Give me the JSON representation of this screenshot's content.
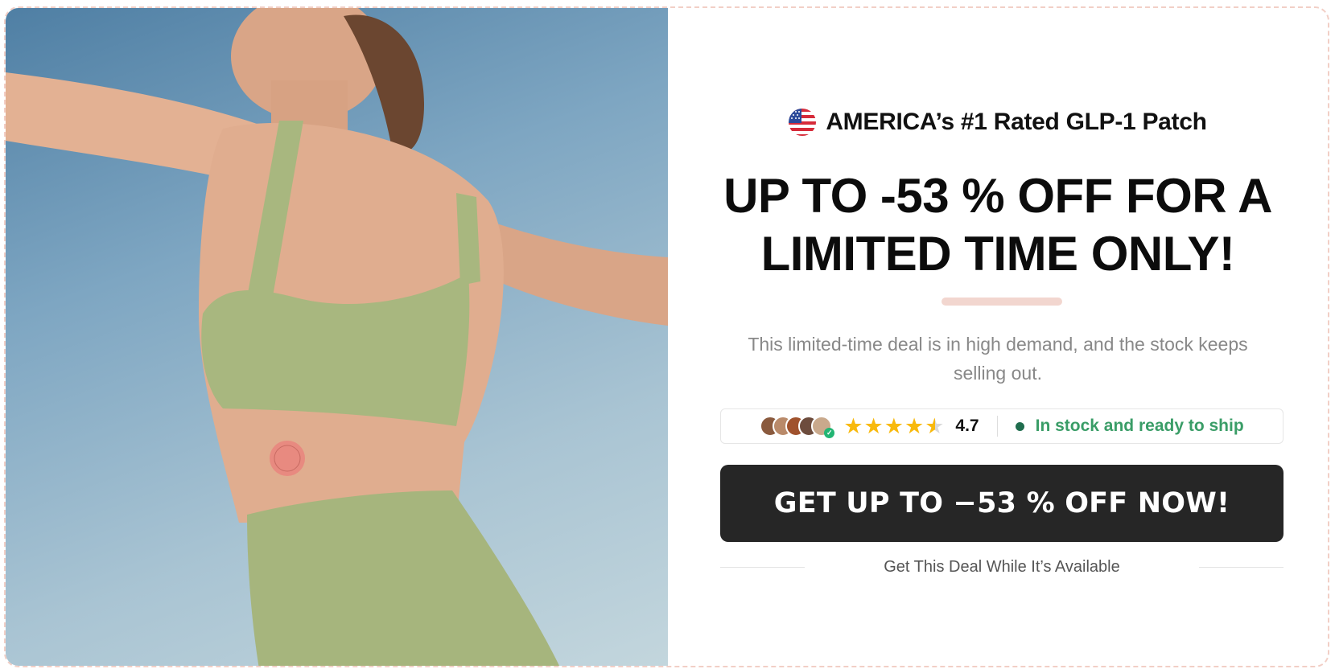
{
  "hero": {
    "image_description": ""
  },
  "badge": {
    "flag_icon": "us-flag-icon",
    "text": "AMERICA’s #1 Rated GLP-1 Patch"
  },
  "headline": {
    "line1": "UP TO -53 % OFF FOR A",
    "line2": "LIMITED TIME ONLY!"
  },
  "subtext": "This limited-time deal is in high demand, and the stock keeps selling out.",
  "social_proof": {
    "avatar_count": 5,
    "rating_value": "4.7",
    "stars": 4.5,
    "stock_status": "In stock and ready to ship"
  },
  "cta": {
    "label": "GET UP TO −53 % OFF NOW!"
  },
  "footer": {
    "text": "Get This Deal While It’s Available"
  },
  "colors": {
    "accent_border": "#f2cfc6",
    "cta_bg": "#262626",
    "star": "#f8b90d",
    "stock_green": "#3a9d67",
    "divider": "#f2d6cf"
  }
}
